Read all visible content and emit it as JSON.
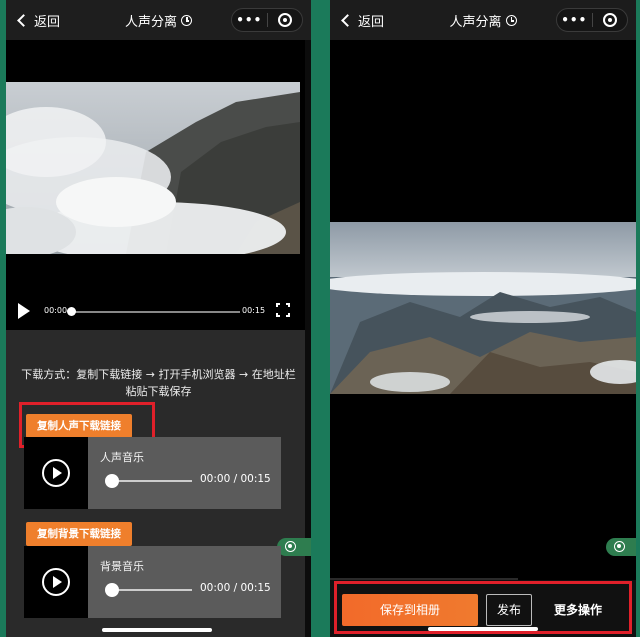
{
  "left": {
    "nav": {
      "back_label": "返回",
      "title": "人声分离",
      "more_label": "•••"
    },
    "player": {
      "current_time": "00:00",
      "duration": "00:15",
      "progress": 0
    },
    "instructions": "下载方式：复制下载链接 → 打开手机浏览器 → 在地址栏粘贴下载保存",
    "vocal_copy_label": "复制人声下载链接",
    "background_copy_label": "复制背景下载链接",
    "tracks": [
      {
        "title": "人声音乐",
        "time": "00:00 / 00:15"
      },
      {
        "title": "背景音乐",
        "time": "00:00 / 00:15"
      }
    ]
  },
  "right": {
    "nav": {
      "back_label": "返回",
      "title": "人声分离",
      "more_label": "•••"
    },
    "save_label": "保存到相册",
    "publish_label": "发布",
    "more_ops_label": "更多操作"
  },
  "colors": {
    "accent_orange": "#ef7f2c",
    "highlight_red": "#e0202a",
    "app_green": "#1b7a5a"
  }
}
